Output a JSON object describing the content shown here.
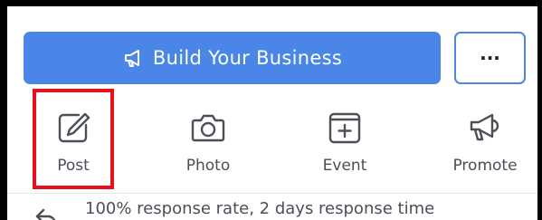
{
  "header": {
    "build_button_label": "Build Your Business",
    "build_button_icon": "megaphone-icon",
    "more_button_label": "···"
  },
  "actions": [
    {
      "label": "Post",
      "icon": "edit-icon"
    },
    {
      "label": "Photo",
      "icon": "camera-icon"
    },
    {
      "label": "Event",
      "icon": "calendar-add-icon"
    },
    {
      "label": "Promote",
      "icon": "megaphone-icon"
    }
  ],
  "highlighted_action": "Post",
  "info": {
    "response_text": "100% response rate, 2 days response time",
    "response_icon": "reply-icon"
  },
  "colors": {
    "primary": "#4a86e8",
    "highlight": "#e8101a",
    "icon": "#4b4f56"
  }
}
